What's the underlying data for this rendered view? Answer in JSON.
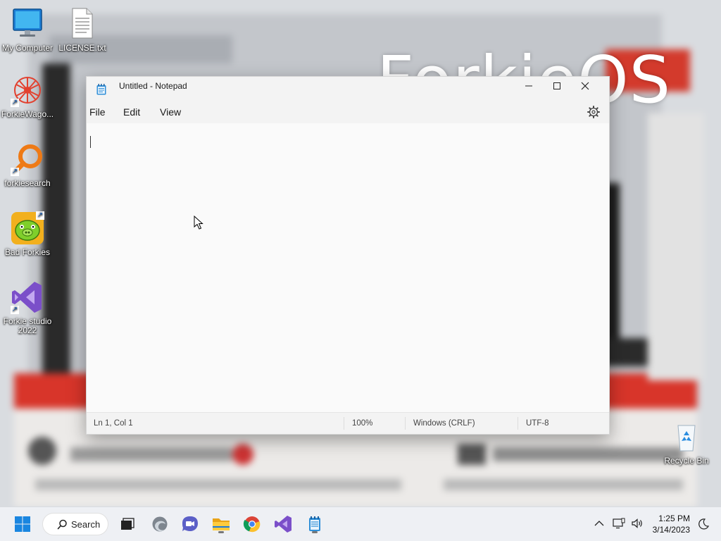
{
  "wallpaper": {
    "brand_text": "ForkieOS"
  },
  "desktop": {
    "icons": [
      {
        "label": "My Computer"
      },
      {
        "label": "LICENSE.txt"
      },
      {
        "label": "ForkieWago..."
      },
      {
        "label": "forkiesearch"
      },
      {
        "label": "Bad Forkies"
      },
      {
        "label": "Forkie studio 2022"
      },
      {
        "label": "Recycle Bin"
      }
    ]
  },
  "notepad": {
    "title": "Untitled - Notepad",
    "menu": [
      "File",
      "Edit",
      "View"
    ],
    "content": "",
    "status": {
      "position": "Ln 1, Col 1",
      "zoom": "100%",
      "line_ending": "Windows (CRLF)",
      "encoding": "UTF-8"
    }
  },
  "taskbar": {
    "search_label": "Search",
    "clock_time": "1:25 PM",
    "clock_date": "3/14/2023"
  },
  "colors": {
    "accent": "#0067c0",
    "window_bg": "#f9f9f9",
    "taskbar_bg": "#eef1f5"
  }
}
